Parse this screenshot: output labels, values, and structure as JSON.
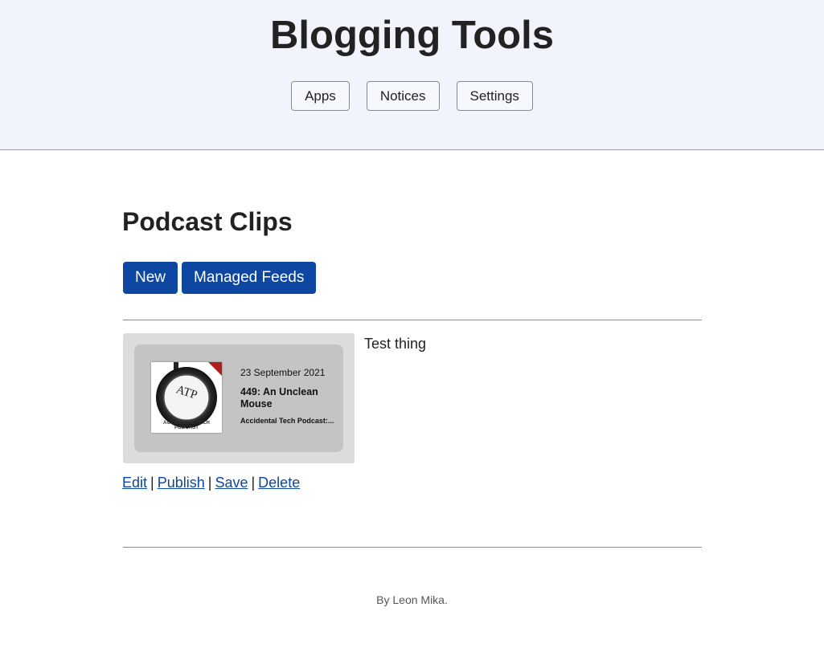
{
  "header": {
    "title": "Blogging Tools",
    "nav": [
      {
        "label": "Apps"
      },
      {
        "label": "Notices"
      },
      {
        "label": "Settings"
      }
    ]
  },
  "main": {
    "heading": "Podcast Clips",
    "actions": {
      "new_label": "New",
      "feeds_label": "Managed Feeds"
    },
    "clips": [
      {
        "title": "Test thing",
        "card": {
          "date": "23 September 2021",
          "episode_title": "449:  An Unclean Mouse",
          "show": "Accidental Tech Podcast:...",
          "cover_logo": "ATP",
          "cover_caption": "ACCIDENTAL TECH PODCAST"
        },
        "links": {
          "edit": "Edit",
          "publish": "Publish",
          "save": "Save",
          "delete": "Delete",
          "separator": "|"
        }
      }
    ]
  },
  "footer": {
    "text": "By Leon Mika."
  },
  "colors": {
    "header_bg": "#f1f3fd",
    "primary": "#0d47a1",
    "link": "#0d47a1"
  }
}
